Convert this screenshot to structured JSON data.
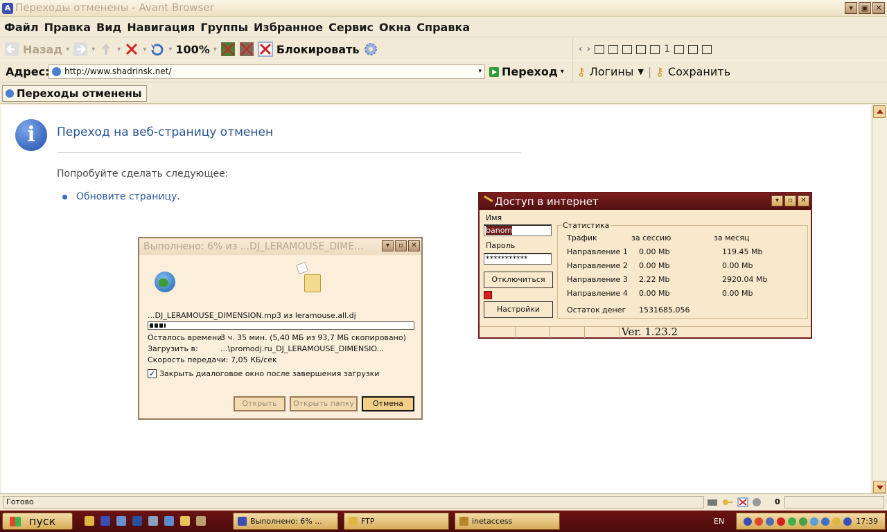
{
  "window": {
    "title": "Переходы отменены - Avant Browser"
  },
  "menu": [
    "Файл",
    "Правка",
    "Вид",
    "Навигация",
    "Группы",
    "Избранное",
    "Сервис",
    "Окна",
    "Справка"
  ],
  "toolbar": {
    "back": "Назад",
    "zoom": "100%",
    "block": "Блокировать",
    "page_count": "1"
  },
  "address": {
    "label": "Адрес:",
    "url": "http://www.shadrinsk.net/",
    "go": "Переход",
    "logins": "Логины",
    "save": "Сохранить"
  },
  "tab": {
    "label": "Переходы отменены"
  },
  "page": {
    "title": "Переход на веб-страницу отменен",
    "suggest": "Попробуйте сделать следующее:",
    "refresh_link": "Обновите страницу."
  },
  "download": {
    "title": "Выполнено: 6% из ...DJ_LERAMOUSE_DIME...",
    "file_line": "...DJ_LERAMOUSE_DIMENSION.mp3 из leramouse.all.dj",
    "progress_percent": 6,
    "time_left_label": "Осталось времени:",
    "time_left_value": "3 ч. 35 мин. (5,40 МБ из 93,7 МБ скопировано)",
    "save_to_label": "Загрузить в:",
    "save_to_value": "...\\promodj.ru_DJ_LERAMOUSE_DIMENSIO...",
    "speed": "Скорость передачи: 7,05 КБ/сек",
    "close_when_done": "Закрыть диалоговое окно после завершения загрузки",
    "close_when_done_checked": true,
    "open": "Открыть",
    "open_folder": "Открыть папку",
    "cancel": "Отмена"
  },
  "inet": {
    "title": "Доступ в интернет",
    "name_label": "Имя",
    "name_value": "banom",
    "password_label": "Пароль",
    "password_value": "***********",
    "disconnect": "Отключиться",
    "settings": "Настройки",
    "stats_legend": "Статистика",
    "headers": [
      "Трафик",
      "за сессию",
      "за месяц"
    ],
    "rows": [
      {
        "name": "Направление 1",
        "session": "0.00 Mb",
        "month": "119.45 Mb"
      },
      {
        "name": "Направление 2",
        "session": "0.00 Mb",
        "month": "0.00 Mb"
      },
      {
        "name": "Направление 3",
        "session": "2.22 Mb",
        "month": "2920.04 Mb"
      },
      {
        "name": "Направление 4",
        "session": "0.00 Mb",
        "month": "0.00 Mb"
      }
    ],
    "balance_label": "Остаток денег",
    "balance_value": "1531685,056",
    "version": "Ver. 1.23.2",
    "status_color": "#e01b1b"
  },
  "status": {
    "text": "Готово",
    "count": "0"
  },
  "taskbar": {
    "start": "пуск",
    "tasks": [
      "Выполнено: 6% ...",
      "FTP",
      "inetaccess"
    ],
    "lang": "EN",
    "clock": "17:39"
  }
}
